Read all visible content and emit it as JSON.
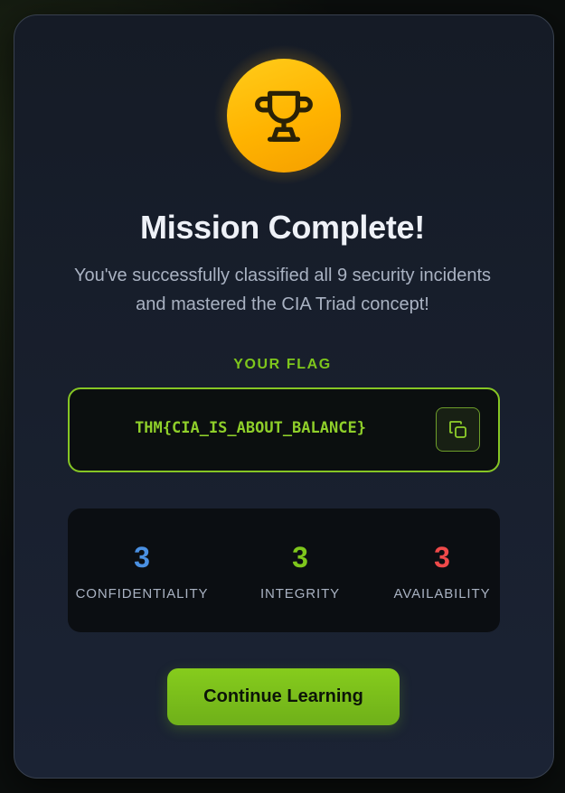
{
  "title": "Mission Complete!",
  "subtitle": "You've successfully classified all 9 security incidents and mastered the CIA Triad concept!",
  "flag": {
    "label": "YOUR FLAG",
    "value": "THM{CIA_IS_ABOUT_BALANCE}",
    "copy_icon": "copy-icon"
  },
  "stats": [
    {
      "value": "3",
      "label": "CONFIDENTIALITY",
      "color": "#4a90e2"
    },
    {
      "value": "3",
      "label": "INTEGRITY",
      "color": "#7ec61c"
    },
    {
      "value": "3",
      "label": "AVAILABILITY",
      "color": "#ef4a4a"
    }
  ],
  "continue_label": "Continue Learning",
  "colors": {
    "accent": "#7ec61c",
    "trophy": "#ffb300",
    "card_bg": "#151b26"
  },
  "icons": {
    "trophy": "trophy-icon"
  }
}
